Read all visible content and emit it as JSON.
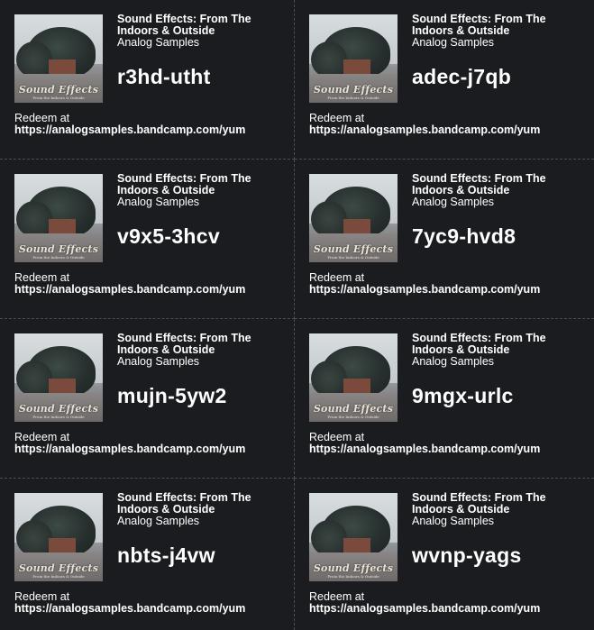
{
  "album": {
    "title": "Sound Effects: From The Indoors & Outside",
    "artist": "Analog Samples",
    "cover_logo_text": "Sound Effects",
    "cover_sub_text": "From the Indoors & Outside"
  },
  "redeem": {
    "label": "Redeem at",
    "url": "https://analogsamples.bandcamp.com/yum"
  },
  "codes": [
    "r3hd-utht",
    "adec-j7qb",
    "v9x5-3hcv",
    "7yc9-hvd8",
    "mujn-5yw2",
    "9mgx-urlc",
    "nbts-j4vw",
    "wvnp-yags"
  ],
  "colors": {
    "background": "#1a1c1f",
    "divider": "#4a4d52",
    "text": "#ffffff"
  }
}
